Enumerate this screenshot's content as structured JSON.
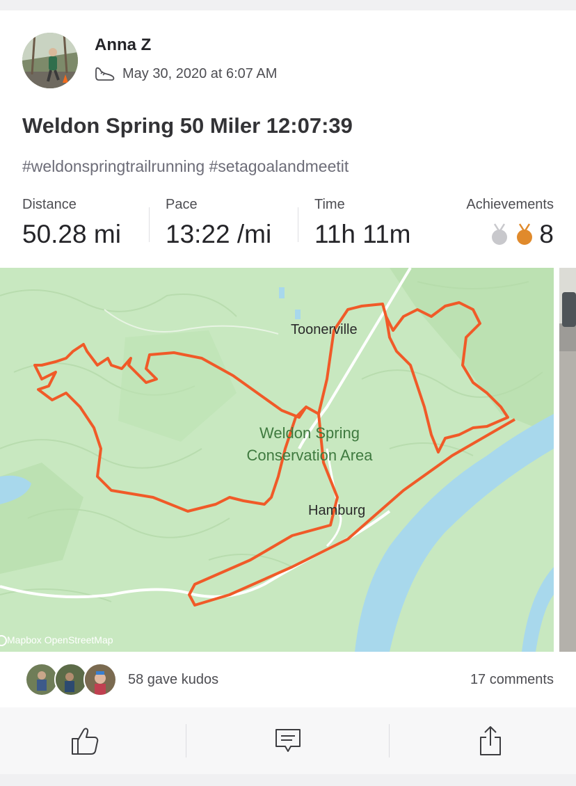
{
  "athlete": {
    "name": "Anna Z",
    "timestamp": "May 30, 2020 at 6:07 AM"
  },
  "activity": {
    "title": "Weldon Spring 50 Miler 12:07:39",
    "description": "#weldonspringtrailrunning #setagoalandmeetit",
    "sport_icon": "running-shoe-icon"
  },
  "stats": {
    "distance": {
      "label": "Distance",
      "value": "50.28 mi"
    },
    "pace": {
      "label": "Pace",
      "value": "13:22 /mi"
    },
    "time": {
      "label": "Time",
      "value": "11h 11m"
    },
    "achievements": {
      "label": "Achievements",
      "count": "8",
      "icons": [
        "silver-medal-icon",
        "bronze-medal-icon"
      ]
    }
  },
  "map": {
    "places": {
      "tooneville": "Toonerville",
      "hamburg": "Hamburg"
    },
    "area_line1": "Weldon Spring",
    "area_line2": "Conservation Area",
    "attribution": "Mapbox  OpenStreetMap"
  },
  "social": {
    "kudos": "58 gave kudos",
    "comments": "17 comments"
  },
  "actions": [
    "kudos-thumb-icon",
    "comment-icon",
    "share-icon"
  ],
  "colors": {
    "route": "#f05a28",
    "map_green": "#c8e8c0",
    "river": "#a8d8ec",
    "silver_medal": "#c8c8cc",
    "bronze_medal": "#e08a2c"
  }
}
